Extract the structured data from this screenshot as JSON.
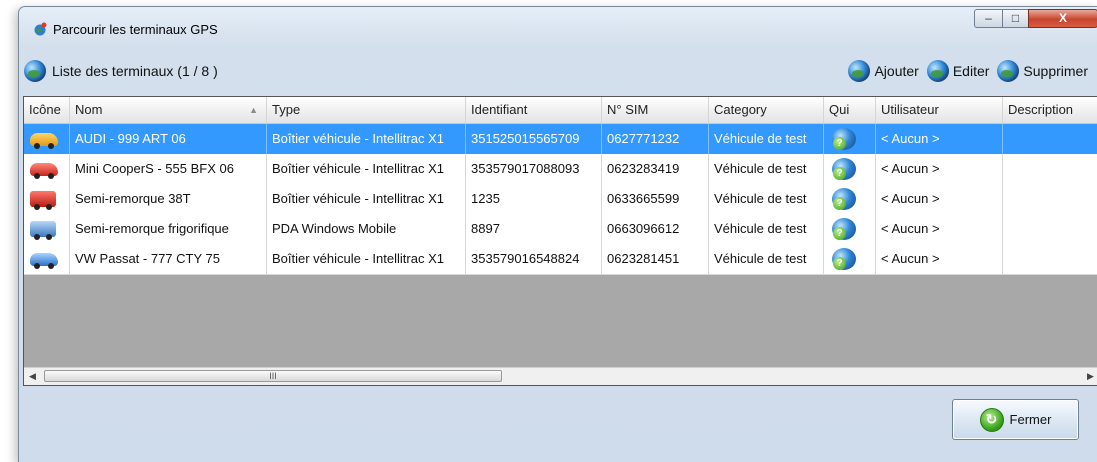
{
  "window": {
    "title": "Parcourir les terminaux GPS",
    "controls": {
      "minimize": "–",
      "maximize": "□",
      "close": "X"
    }
  },
  "toolbar": {
    "list_label": "Liste des terminaux  (1 / 8 )",
    "add_label": "Ajouter",
    "edit_label": "Editer",
    "delete_label": "Supprimer"
  },
  "grid": {
    "columns": [
      "Icône",
      "Nom",
      "Type",
      "Identifiant",
      "N° SIM",
      "Category",
      "Qui",
      "Utilisateur",
      "Description"
    ],
    "sort_indicator": "▲",
    "rows": [
      {
        "icon": "yellow-car-icon",
        "nom": "AUDI - 999 ART 06",
        "type": "Boîtier véhicule - Intellitrac X1",
        "identifiant": "351525015565709",
        "sim": "0627771232",
        "category": "Véhicule de test",
        "qui_icon": "user-globe-icon",
        "utilisateur": "< Aucun >",
        "description": "",
        "selected": true
      },
      {
        "icon": "red-car-icon",
        "nom": "Mini CooperS - 555 BFX 06",
        "type": "Boîtier véhicule - Intellitrac X1",
        "identifiant": "353579017088093",
        "sim": "0623283419",
        "category": "Véhicule de test",
        "qui_icon": "user-globe-icon",
        "utilisateur": "< Aucun >",
        "description": "",
        "selected": false
      },
      {
        "icon": "red-truck-icon",
        "nom": "Semi-remorque 38T",
        "type": "Boîtier véhicule - Intellitrac X1",
        "identifiant": "1235",
        "sim": "0633665599",
        "category": "Véhicule de test",
        "qui_icon": "user-globe-icon",
        "utilisateur": "< Aucun >",
        "description": "",
        "selected": false
      },
      {
        "icon": "blue-truck-icon",
        "nom": "Semi-remorque frigorifique",
        "type": "PDA Windows Mobile",
        "identifiant": "8897",
        "sim": "0663096612",
        "category": "Véhicule de test",
        "qui_icon": "user-globe-icon",
        "utilisateur": "< Aucun >",
        "description": "",
        "selected": false
      },
      {
        "icon": "blue-car-icon",
        "nom": "VW Passat - 777 CTY 75",
        "type": "Boîtier véhicule - Intellitrac X1",
        "identifiant": "353579016548824",
        "sim": "0623281451",
        "category": "Véhicule de test",
        "qui_icon": "user-globe-icon",
        "utilisateur": "< Aucun >",
        "description": "",
        "selected": false
      }
    ],
    "scroll": {
      "left": "◀",
      "right": "▶",
      "thumb_grip": "III"
    }
  },
  "footer": {
    "close_label": "Fermer"
  },
  "colors": {
    "selection": "#3399ff",
    "grid_empty": "#a8a8a8"
  }
}
